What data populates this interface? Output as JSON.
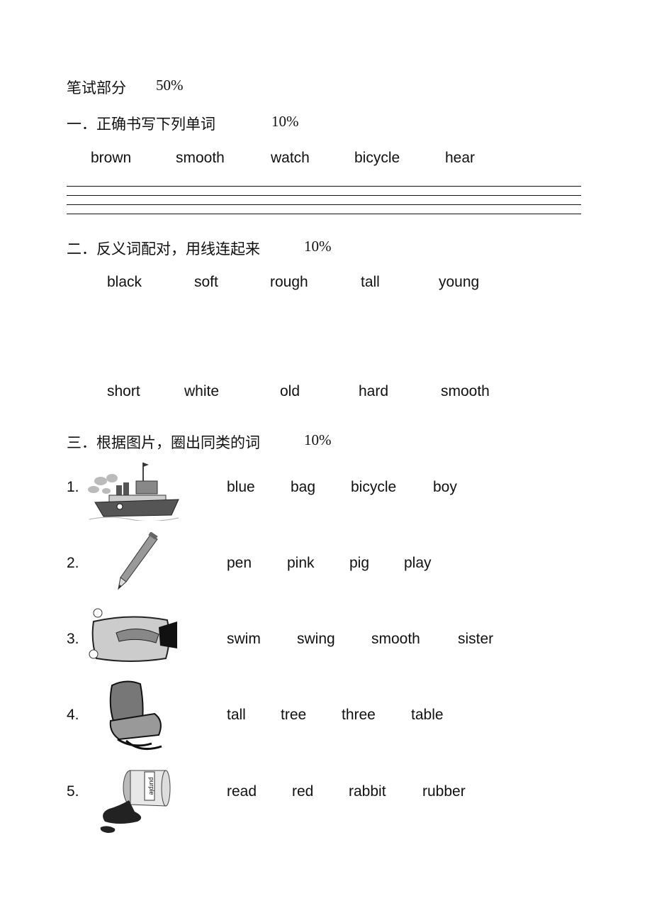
{
  "header": {
    "title": "笔试部分",
    "percent": "50%"
  },
  "section1": {
    "title": "一．正确书写下列单词",
    "percent": "10%",
    "words": [
      "brown",
      "smooth",
      "watch",
      "bicycle",
      "hear"
    ]
  },
  "section2": {
    "title": "二．反义词配对，用线连起来",
    "percent": "10%",
    "top_words": [
      "black",
      "soft",
      "rough",
      "tall",
      "young"
    ],
    "bottom_words": [
      "short",
      "white",
      "old",
      "hard",
      "smooth"
    ]
  },
  "section3": {
    "title": "三．根据图片，圈出同类的词",
    "percent": "10%",
    "items": [
      {
        "number": "1.",
        "picture": "ship",
        "words": [
          "blue",
          "bag",
          "bicycle",
          "boy"
        ]
      },
      {
        "number": "2.",
        "picture": "pencil",
        "words": [
          "pen",
          "pink",
          "pig",
          "play"
        ]
      },
      {
        "number": "3.",
        "picture": "pillow",
        "words": [
          "swim",
          "swing",
          "smooth",
          "sister"
        ]
      },
      {
        "number": "4.",
        "picture": "chair",
        "words": [
          "tall",
          "tree",
          "three",
          "table"
        ]
      },
      {
        "number": "5.",
        "picture": "paint-can",
        "label": "purple",
        "words": [
          "read",
          "red",
          "rabbit",
          "rubber"
        ]
      }
    ]
  }
}
